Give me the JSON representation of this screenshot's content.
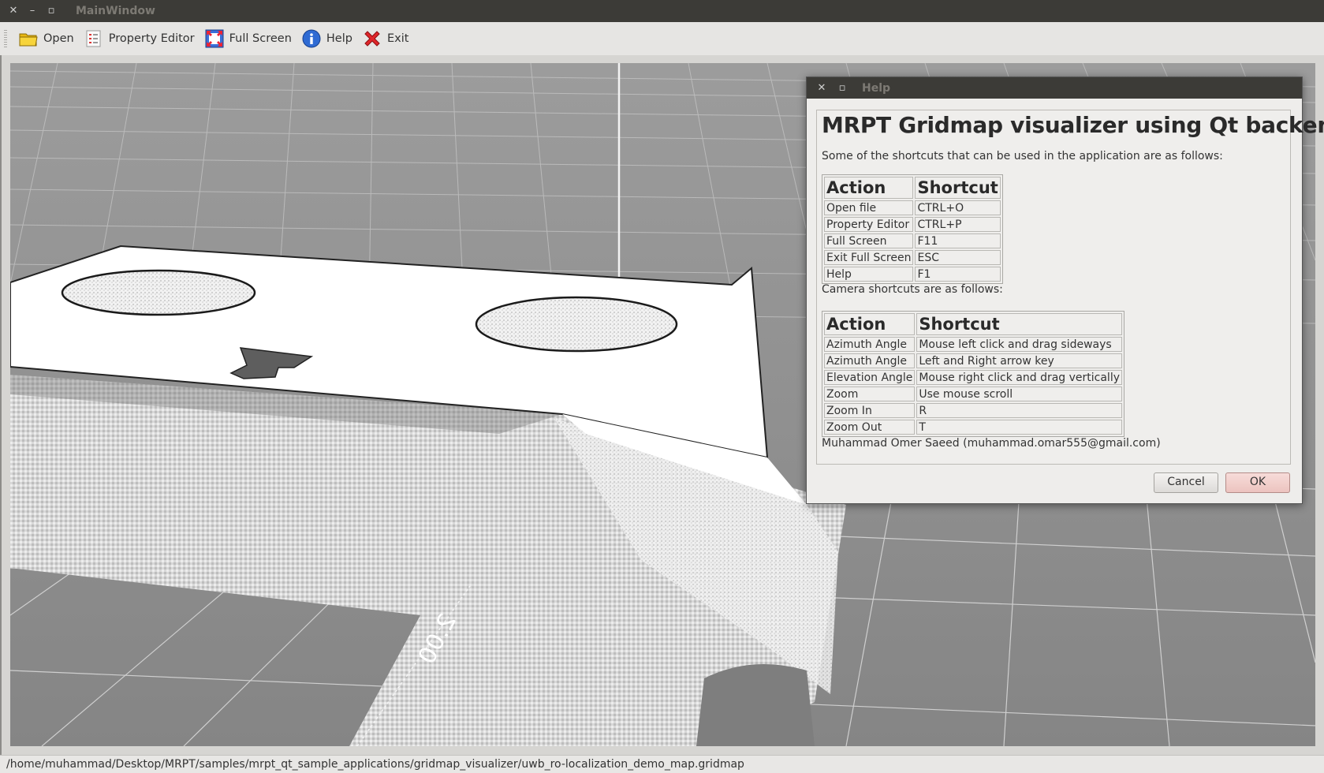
{
  "window": {
    "title": "MainWindow",
    "controls": [
      "close-icon",
      "minimize-icon",
      "maximize-icon"
    ]
  },
  "toolbar": {
    "items": [
      {
        "label": "Open",
        "icon": "folder-icon"
      },
      {
        "label": "Property Editor",
        "icon": "property-editor-icon"
      },
      {
        "label": "Full Screen",
        "icon": "fullscreen-icon"
      },
      {
        "label": "Help",
        "icon": "info-icon"
      },
      {
        "label": "Exit",
        "icon": "exit-icon"
      }
    ]
  },
  "viewport": {
    "axis_label": "2.00"
  },
  "dialog": {
    "title": "Help",
    "heading": "MRPT Gridmap visualizer using Qt backend",
    "intro": "Some of the shortcuts that can be used in the application are as follows:",
    "table1": {
      "headers": [
        "Action",
        "Shortcut"
      ],
      "rows": [
        [
          "Open file",
          "CTRL+O"
        ],
        [
          "Property Editor",
          "CTRL+P"
        ],
        [
          "Full Screen",
          "F11"
        ],
        [
          "Exit Full Screen",
          "ESC"
        ],
        [
          "Help",
          "F1"
        ]
      ]
    },
    "camera_intro": "Camera shortcuts are as follows:",
    "table2": {
      "headers": [
        "Action",
        "Shortcut"
      ],
      "rows": [
        [
          "Azimuth Angle",
          "Mouse left click and drag sideways"
        ],
        [
          "Azimuth Angle",
          "Left and Right arrow key"
        ],
        [
          "Elevation Angle",
          "Mouse right click and drag vertically"
        ],
        [
          "Zoom",
          "Use mouse scroll"
        ],
        [
          "Zoom In",
          "R"
        ],
        [
          "Zoom Out",
          "T"
        ]
      ]
    },
    "author": "Muhammad Omer Saeed (muhammad.omar555@gmail.com)",
    "buttons": {
      "cancel": "Cancel",
      "ok": "OK"
    }
  },
  "status": {
    "path": "/home/muhammad/Desktop/MRPT/samples/mrpt_qt_sample_applications/gridmap_visualizer/uwb_ro-localization_demo_map.gridmap"
  }
}
